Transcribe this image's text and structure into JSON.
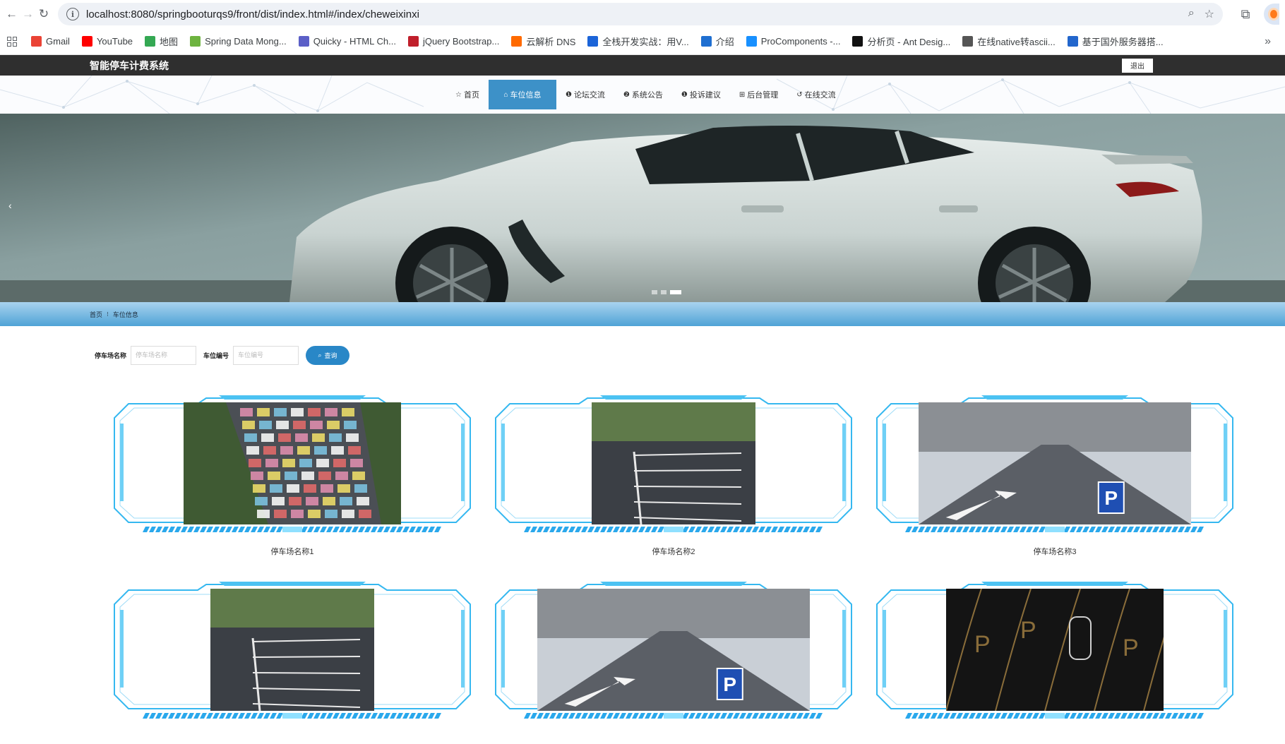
{
  "browser": {
    "url": "localhost:8080/springbooturqs9/front/dist/index.html#/index/cheweixinxi",
    "bookmarks": [
      {
        "label": "Gmail",
        "icon": "gmail-icon",
        "color": "#ea4335"
      },
      {
        "label": "YouTube",
        "icon": "youtube-icon",
        "color": "#ff0000"
      },
      {
        "label": "地图",
        "icon": "maps-icon",
        "color": "#34a853"
      },
      {
        "label": "Spring Data Mong...",
        "icon": "spring-icon",
        "color": "#6db33f"
      },
      {
        "label": "Quicky - HTML Ch...",
        "icon": "quicky-icon",
        "color": "#5b5fc7"
      },
      {
        "label": "jQuery Bootstrap...",
        "icon": "jquery-icon",
        "color": "#c01f2b"
      },
      {
        "label": "云解析 DNS",
        "icon": "aliyun-icon",
        "color": "#ff6a00"
      },
      {
        "label": "全栈开发实战：用V...",
        "icon": "m-icon",
        "color": "#1b64d8"
      },
      {
        "label": "介绍",
        "icon": "globe-icon",
        "color": "#1f6fd1"
      },
      {
        "label": "ProComponents -...",
        "icon": "procomponents-icon",
        "color": "#1890ff"
      },
      {
        "label": "分析页 - Ant Desig...",
        "icon": "pro-icon",
        "color": "#111111"
      },
      {
        "label": "在线native转ascii...",
        "icon": "web-icon",
        "color": "#555555"
      },
      {
        "label": "基于国外服务器搭...",
        "icon": "star-icon",
        "color": "#2266cc"
      }
    ]
  },
  "site": {
    "title": "智能停车计费系统",
    "logout": "退出",
    "nav": [
      {
        "label": "首页",
        "icon": "☆",
        "active": false
      },
      {
        "label": "车位信息",
        "icon": "⌂",
        "active": true
      },
      {
        "label": "论坛交流",
        "icon": "❶",
        "active": false
      },
      {
        "label": "系统公告",
        "icon": "❷",
        "active": false
      },
      {
        "label": "投诉建议",
        "icon": "❶",
        "active": false
      },
      {
        "label": "后台管理",
        "icon": "⊞",
        "active": false
      },
      {
        "label": "在线交流",
        "icon": "↺",
        "active": false
      }
    ]
  },
  "breadcrumb": {
    "home": "首页",
    "separator": "⁝",
    "current": "车位信息"
  },
  "search": {
    "field1_label": "停车场名称",
    "field1_placeholder": "停车场名称",
    "field2_label": "车位编号",
    "field2_placeholder": "车位编号",
    "button": "查询"
  },
  "cards": [
    {
      "caption": "停车场名称1",
      "photo": "aerial-parking-lot"
    },
    {
      "caption": "停车场名称2",
      "photo": "asphalt-parking-lot"
    },
    {
      "caption": "停车场名称3",
      "photo": "street-parking"
    },
    {
      "caption": "",
      "photo": "asphalt-parking-lot"
    },
    {
      "caption": "",
      "photo": "street-parking"
    },
    {
      "caption": "",
      "photo": "night-parking-p"
    }
  ],
  "colors": {
    "accent": "#3d91c8",
    "frame": "#35b8f0",
    "topbar": "#2f2f2f"
  }
}
